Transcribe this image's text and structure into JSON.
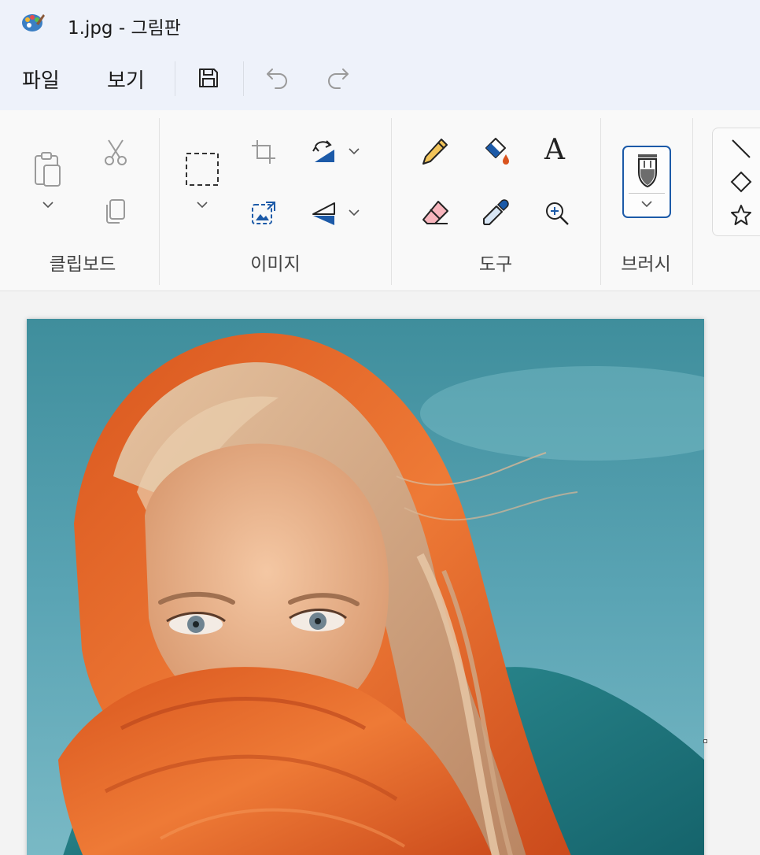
{
  "window": {
    "title": "1.jpg - 그림판"
  },
  "menu": {
    "file": "파일",
    "view": "보기"
  },
  "toolbar": {
    "save": "save-icon",
    "undo": "undo-icon",
    "redo": "redo-icon"
  },
  "ribbon": {
    "groups": {
      "clipboard": "클립보드",
      "image": "이미지",
      "tools": "도구",
      "brushes": "브러시"
    }
  },
  "colors": {
    "titlebar_bg": "#eef2fa",
    "ribbon_bg": "#f9f9f9",
    "accent": "#1c5aa8",
    "canvas_sky": "#4f9aa8",
    "scarf": "#e0662a",
    "cloth": "#1f7a80"
  },
  "canvas": {
    "content": "photo-girl-orange-scarf"
  }
}
